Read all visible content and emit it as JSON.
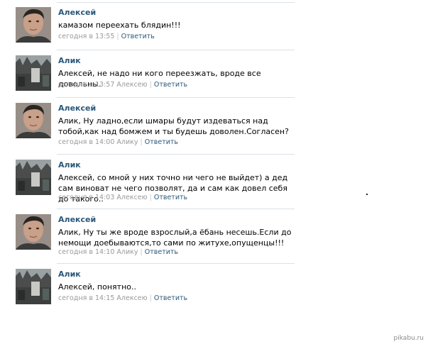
{
  "comments": [
    {
      "author": "Алексей",
      "avatar": "man-avatar",
      "text": "камазом переехать блядин!!!",
      "time": "сегодня в 13:55",
      "recipient": "",
      "reply": "Ответить"
    },
    {
      "author": "Алик",
      "avatar": "street-avatar",
      "text": "Алексей, не надо ни кого переезжать, вроде все довольны.",
      "time": "сегодня в 13:57",
      "recipient": "Алексею",
      "reply": "Ответить"
    },
    {
      "author": "Алексей",
      "avatar": "man-avatar",
      "text": "Алик, Ну ладно,если шмары будут издеваться над тобой,как над бомжем и ты будешь доволен.Согласен?",
      "time": "сегодня в 14:00",
      "recipient": "Алику",
      "reply": "Ответить"
    },
    {
      "author": "Алик",
      "avatar": "street-avatar",
      "text": "Алексей, со мной у них точно ни чего не выйдет) а дед сам виноват не чего позволят, да и сам как довел себя до такого..",
      "time": "сегодня в 14:03",
      "recipient": "Алексею",
      "reply": "Ответить"
    },
    {
      "author": "Алексей",
      "avatar": "man-avatar",
      "text": "Алик, Ну ты же вроде взрослый,а ёбань несешь.Если до немощи доебываются,то сами по житухе,опущенцы!!!",
      "time": "сегодня в 14:10",
      "recipient": "Алику",
      "reply": "Ответить"
    },
    {
      "author": "Алик",
      "avatar": "street-avatar",
      "text": "Алексей, понятно..",
      "time": "сегодня в 14:15",
      "recipient": "Алексею",
      "reply": "Ответить"
    }
  ],
  "watermark": "pikabu.ru"
}
